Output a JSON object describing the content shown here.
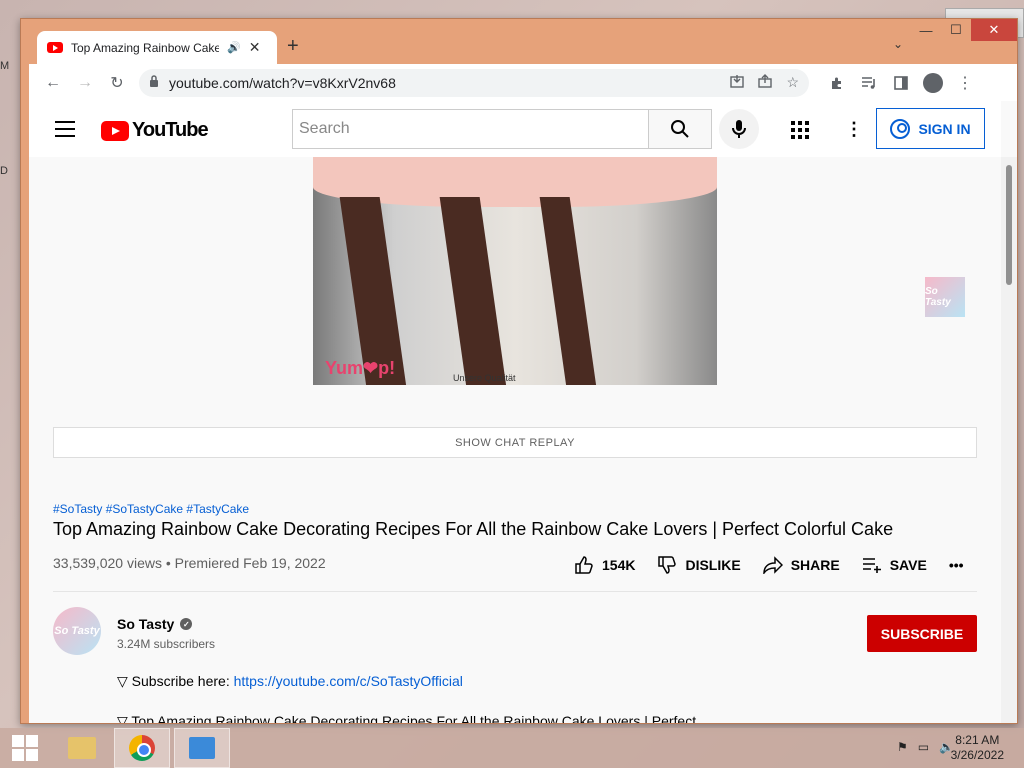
{
  "desktop": {
    "left_labels": [
      "M",
      "D"
    ]
  },
  "window": {
    "controls": {
      "minimize": "—",
      "maximize": "☐",
      "close": "✕"
    }
  },
  "tab": {
    "title": "Top Amazing Rainbow Cake Decorating Recipes For All the Rainbow Cake Lovers",
    "audio_icon": "🔊",
    "close": "✕",
    "newtab": "+",
    "dropdown": "⌄"
  },
  "toolbar": {
    "back": "←",
    "forward": "→",
    "reload": "↻",
    "url": "youtube.com/watch?v=v8KxrV2nv68",
    "menu": "⋮"
  },
  "youtube": {
    "logo_text": "YouTube",
    "search_placeholder": "Search",
    "signin_label": "SIGN IN",
    "video_watermark": "Yum❤p!",
    "video_label": "Unsere Qualität",
    "channel_watermark": "So Tasty",
    "chat_replay_label": "SHOW CHAT REPLAY",
    "hashtags": "#SoTasty #SoTastyCake #TastyCake",
    "video_title": "Top Amazing Rainbow Cake Decorating Recipes For All the Rainbow Cake Lovers | Perfect Colorful Cake",
    "views": "33,539,020 views • Premiered Feb 19, 2022",
    "likes": "154K",
    "dislike_label": "DISLIKE",
    "share_label": "SHARE",
    "save_label": "SAVE",
    "more": "•••",
    "channel": {
      "name": "So Tasty",
      "avatar_text": "So Tasty",
      "subscribers": "3.24M subscribers",
      "subscribe_label": "SUBSCRIBE"
    },
    "description": {
      "line1_prefix": "▽ Subscribe here: ",
      "line1_link": "https://youtube.com/c/SoTastyOfficial",
      "line2": "▽ Top Amazing Rainbow Cake Decorating Recipes For All the Rainbow Cake Lovers | Perfect"
    }
  },
  "taskbar": {
    "time": "8:21 AM",
    "date": "3/26/2022"
  }
}
